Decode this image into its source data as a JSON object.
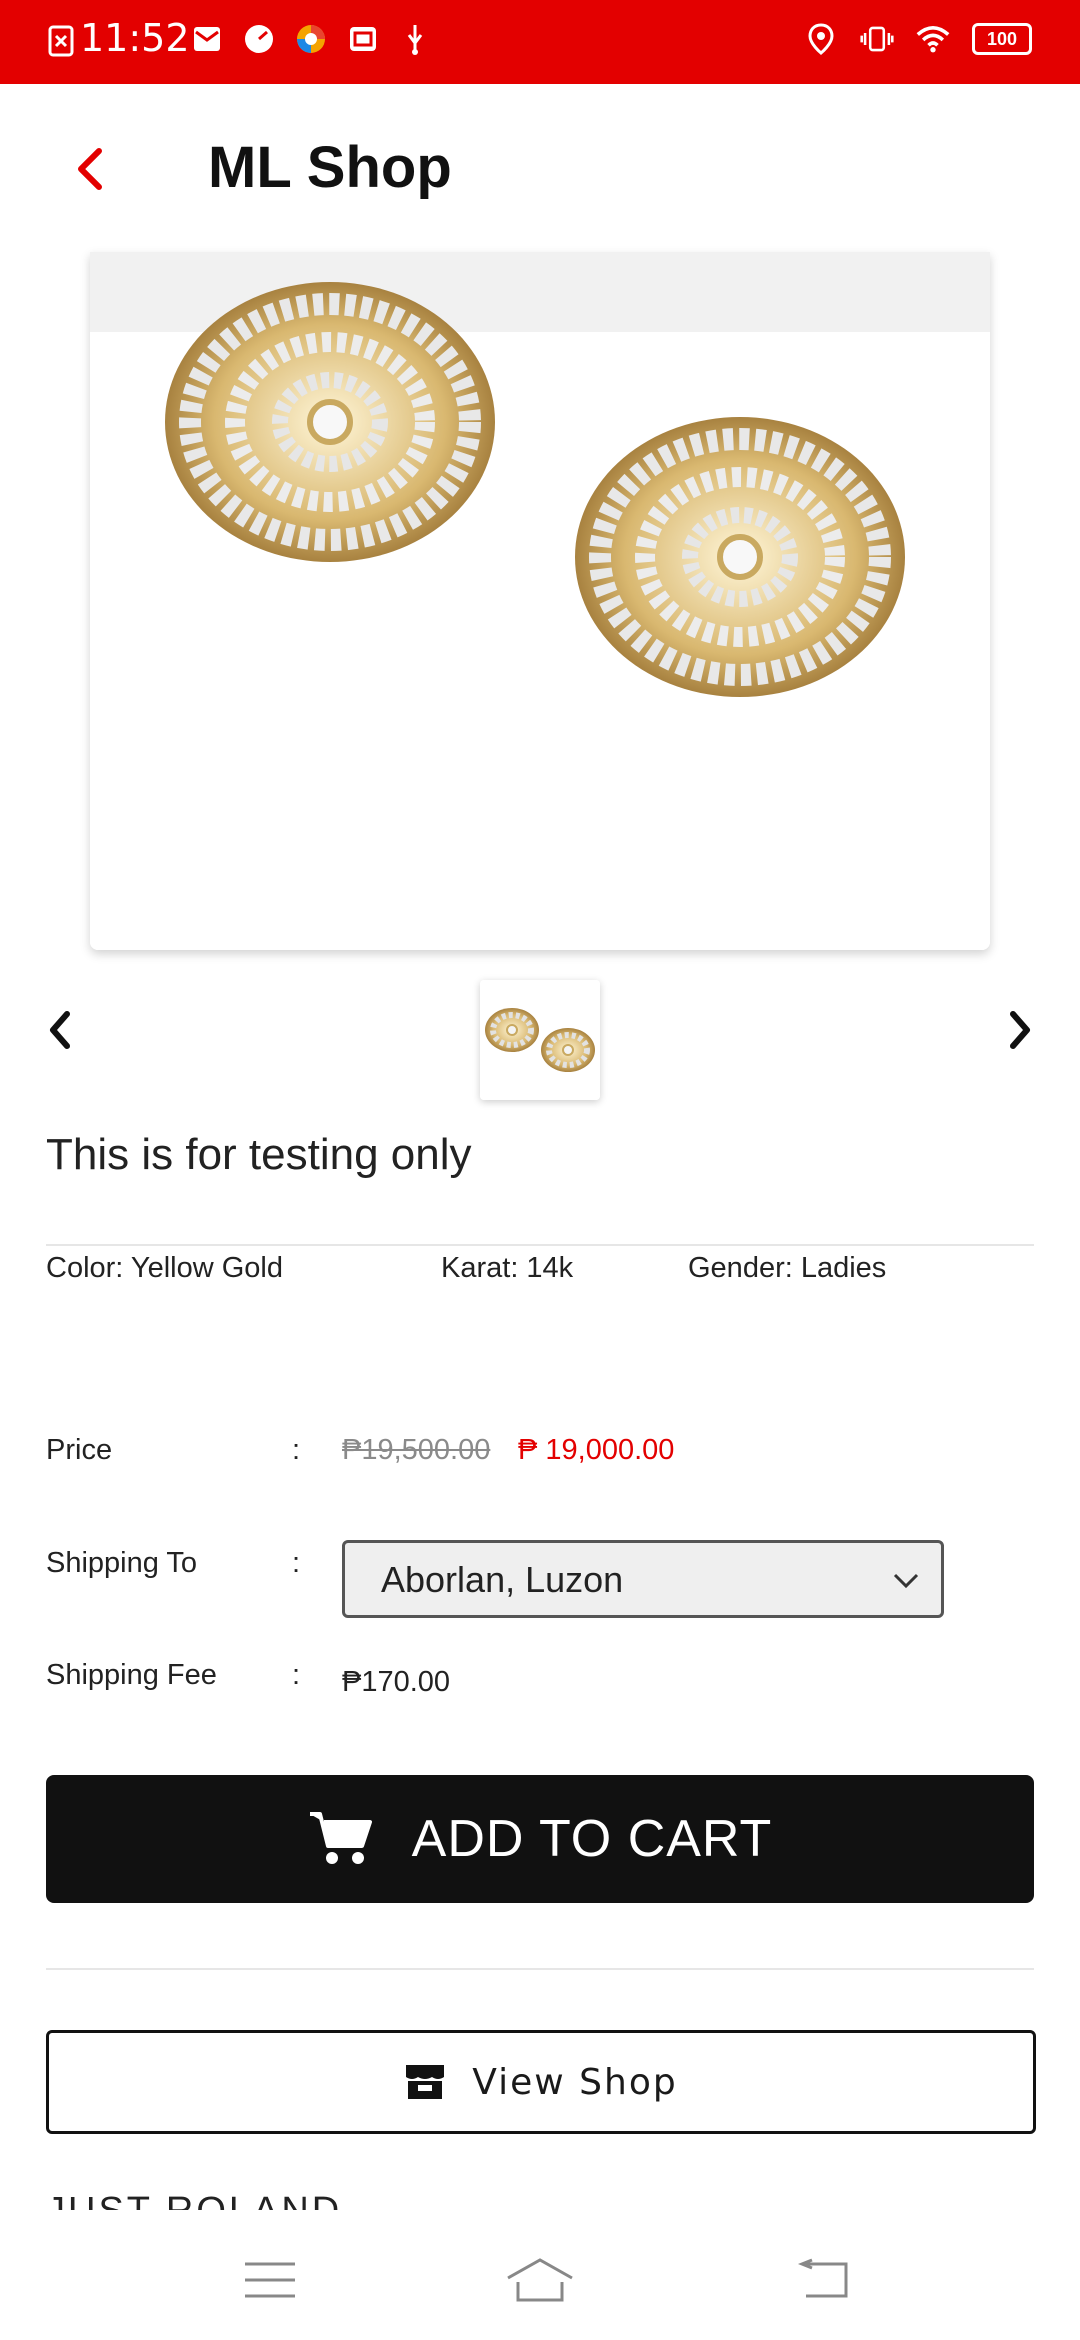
{
  "status_bar": {
    "time": "11:52",
    "battery": "100",
    "left_icons": [
      "sim-error-icon",
      "mail-icon",
      "speed-icon",
      "browser-icon",
      "inbox-icon",
      "usb-icon"
    ],
    "right_icons": [
      "location-icon",
      "vibrate-icon",
      "wifi-icon",
      "battery-icon"
    ]
  },
  "app_bar": {
    "title": "ML Shop",
    "back_icon": "chevron-left-icon"
  },
  "colors": {
    "brand_red": "#e30000",
    "button_dark": "#111111"
  },
  "product": {
    "name": "This is for testing only",
    "attributes": {
      "color": "Color: Yellow Gold",
      "karat": "Karat: 14k",
      "gender": "Gender: Ladies"
    },
    "price_label": "Price",
    "colon": ":",
    "old_price": "₱19,500.00",
    "new_price": "₱ 19,000.00",
    "shipping_to_label": "Shipping To",
    "shipping_to_value": "Aborlan, Luzon",
    "shipping_fee_label": "Shipping Fee",
    "shipping_fee_value": "₱170.00"
  },
  "actions": {
    "add_to_cart": "ADD TO CART",
    "view_shop": "View Shop"
  },
  "seller": {
    "name": "JUST ROLAND"
  },
  "nav_bar": {
    "icons": [
      "menu-icon",
      "home-icon",
      "back-icon"
    ]
  }
}
